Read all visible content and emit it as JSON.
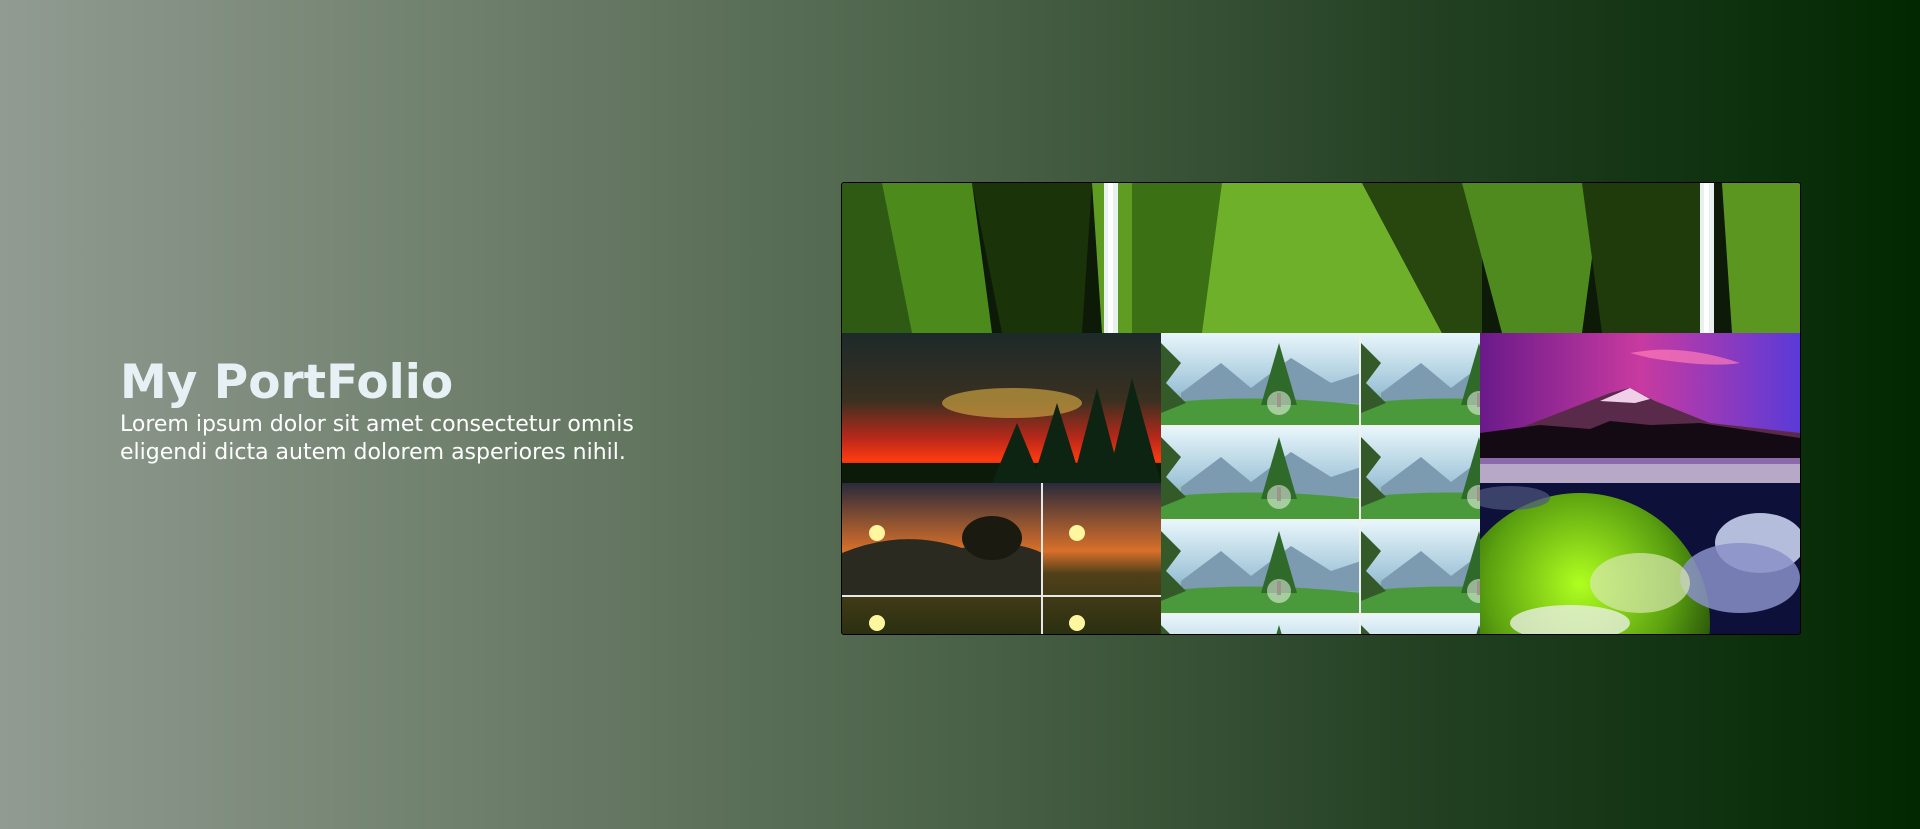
{
  "hero": {
    "title": "My PortFolio",
    "description": "Lorem ipsum dolor sit amet consectetur omnis eligendi dicta autem dolorem asperiores nihil."
  },
  "gallery": {
    "images": [
      {
        "name": "waterfall-cliffs",
        "subject": "green mossy cliffs with waterfall"
      },
      {
        "name": "red-sunset-forest",
        "subject": "dark clouds over red sunset and pine forest"
      },
      {
        "name": "sunrise-hills",
        "subject": "sun rising over hills with tree"
      },
      {
        "name": "lone-tree-meadow",
        "subject": "lone tree in meadow with mountains"
      },
      {
        "name": "purple-mountain-lake",
        "subject": "snowy mountain under purple sky over lake"
      },
      {
        "name": "green-planet-clouds",
        "subject": "green planet among clouds"
      }
    ]
  },
  "colors": {
    "gradient_start": "#919b92",
    "gradient_end": "#012801",
    "title_color": "#e6f0f5"
  }
}
